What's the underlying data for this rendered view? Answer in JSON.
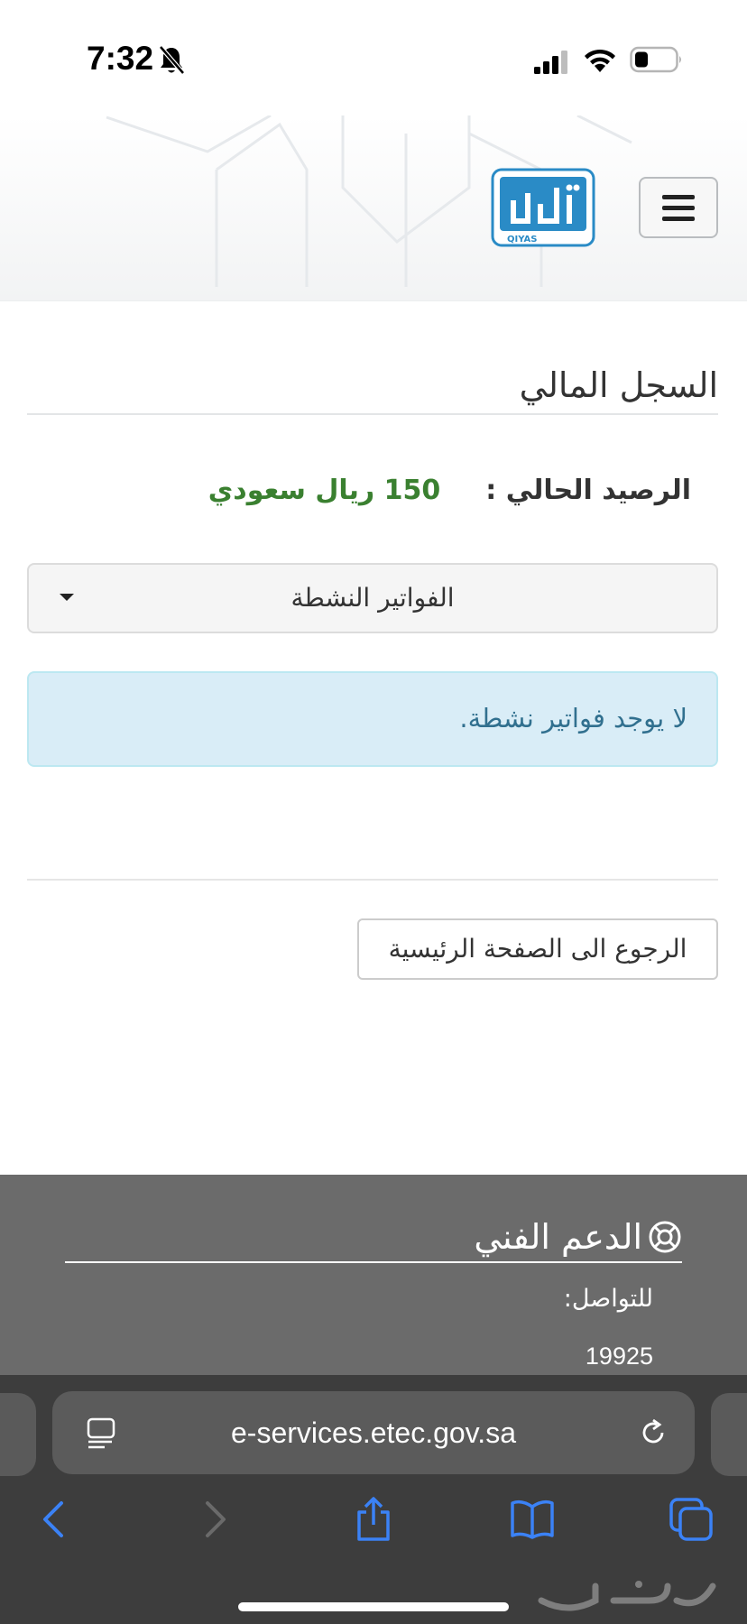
{
  "status_bar": {
    "time": "7:32"
  },
  "header": {
    "logo_text": "QIYAS",
    "menu_icon": "hamburger-icon"
  },
  "main": {
    "page_title": "السجل المالي",
    "balance_label": "الرصيد الحالي :",
    "balance_value": "150 ريال سعودي",
    "invoice_select_label": "الفواتير النشطة",
    "alert_text": "لا يوجد فواتير نشطة.",
    "home_button_label": "الرجوع الى الصفحة الرئيسية"
  },
  "footer": {
    "support_title": "الدعم الفني",
    "contact_label": "للتواصل:",
    "contact_number": "19925"
  },
  "browser": {
    "url": "e-services.etec.gov.sa",
    "icons": [
      "page-menu-icon",
      "reload-icon",
      "back-icon",
      "forward-icon",
      "share-icon",
      "bookmarks-icon",
      "tabs-icon"
    ]
  },
  "colors": {
    "balance_green": "#3a8030",
    "alert_bg": "#d9edf7",
    "alert_text": "#31708f",
    "footer_bg": "#6b6b6b",
    "browser_bg": "#3d3d3d",
    "ios_blue": "#3b82f6"
  }
}
